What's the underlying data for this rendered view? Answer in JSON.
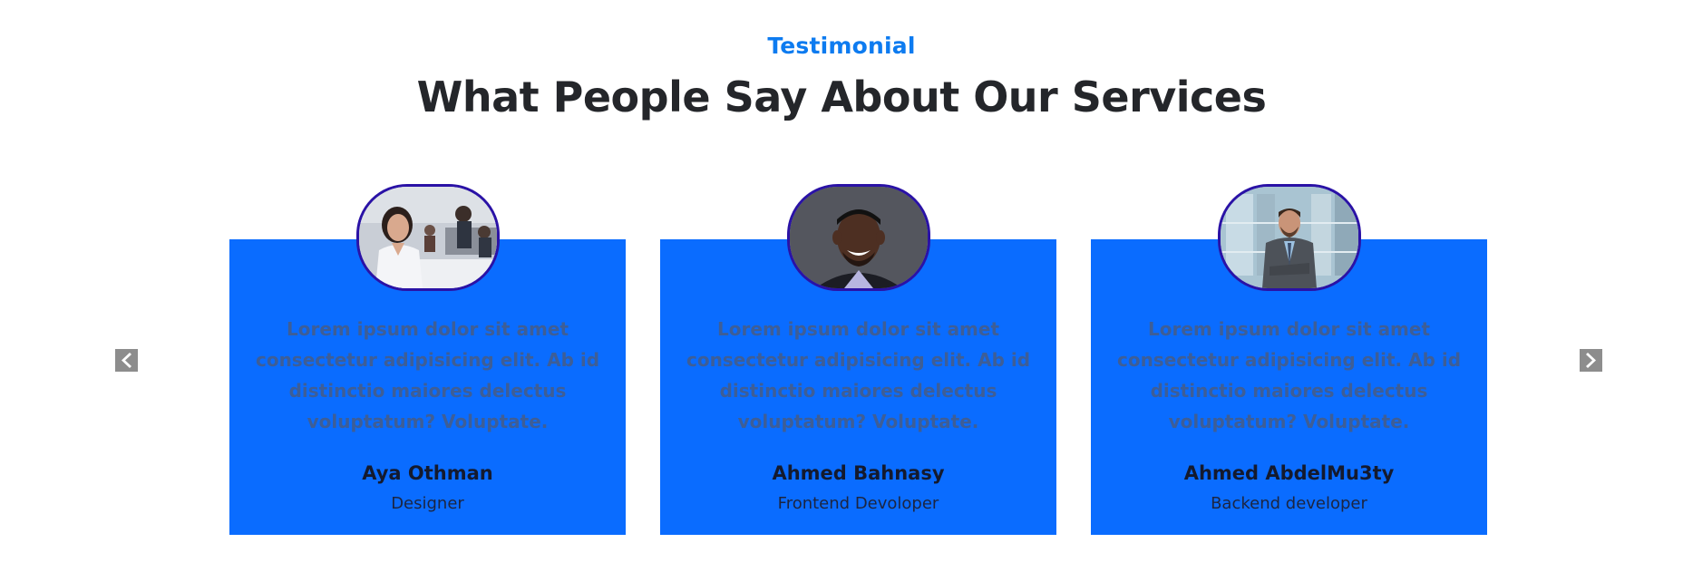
{
  "section": {
    "eyebrow": "Testimonial",
    "heading": "What People Say About Our Services"
  },
  "colors": {
    "accent": "#0d7bf0",
    "card_background": "#0a6cff",
    "avatar_border": "#2a12a6",
    "heading": "#24262a",
    "arrow": "#8d8d8d"
  },
  "slider": {
    "prev_icon": "chevron-left-icon",
    "next_icon": "chevron-right-icon"
  },
  "testimonials": [
    {
      "quote": "Lorem ipsum dolor sit amet consectetur adipisicing elit. Ab id distinctio maiores delectus voluptatum? Voluptate.",
      "name": "Aya Othman",
      "role": "Designer",
      "avatar": "woman-office-photo"
    },
    {
      "quote": "Lorem ipsum dolor sit amet consectetur adipisicing elit. Ab id distinctio maiores delectus voluptatum? Voluptate.",
      "name": "Ahmed Bahnasy",
      "role": "Frontend Devoloper",
      "avatar": "man-portrait-photo"
    },
    {
      "quote": "Lorem ipsum dolor sit amet consectetur adipisicing elit. Ab id distinctio maiores delectus voluptatum? Voluptate.",
      "name": "Ahmed AbdelMu3ty",
      "role": "Backend developer",
      "avatar": "businessman-photo"
    }
  ]
}
